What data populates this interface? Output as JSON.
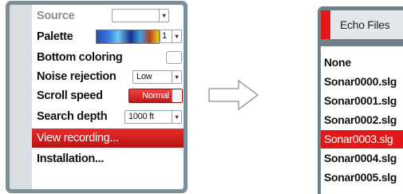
{
  "menu": {
    "source_label": "Source",
    "palette_label": "Palette",
    "palette_value": "1",
    "bottom_coloring_label": "Bottom coloring",
    "noise_rejection_label": "Noise rejection",
    "noise_rejection_value": "Low",
    "scroll_speed_label": "Scroll speed",
    "scroll_speed_value": "Normal",
    "search_depth_label": "Search depth",
    "search_depth_value": "1000 ft",
    "view_recording_label": "View recording...",
    "installation_label": "Installation..."
  },
  "dialog": {
    "title": "Echo Files",
    "files": [
      "None",
      "Sonar0000.slg",
      "Sonar0001.slg",
      "Sonar0002.slg",
      "Sonar0003.slg",
      "Sonar0004.slg",
      "Sonar0005.slg"
    ],
    "selected": "Sonar0003.slg"
  },
  "colors": {
    "accent_red": "#e01818",
    "panel_frame": "#7c8e99"
  },
  "icons": {
    "transition_arrow": "right-arrow-outline-icon",
    "dropdown": "chevron-down-icon"
  }
}
